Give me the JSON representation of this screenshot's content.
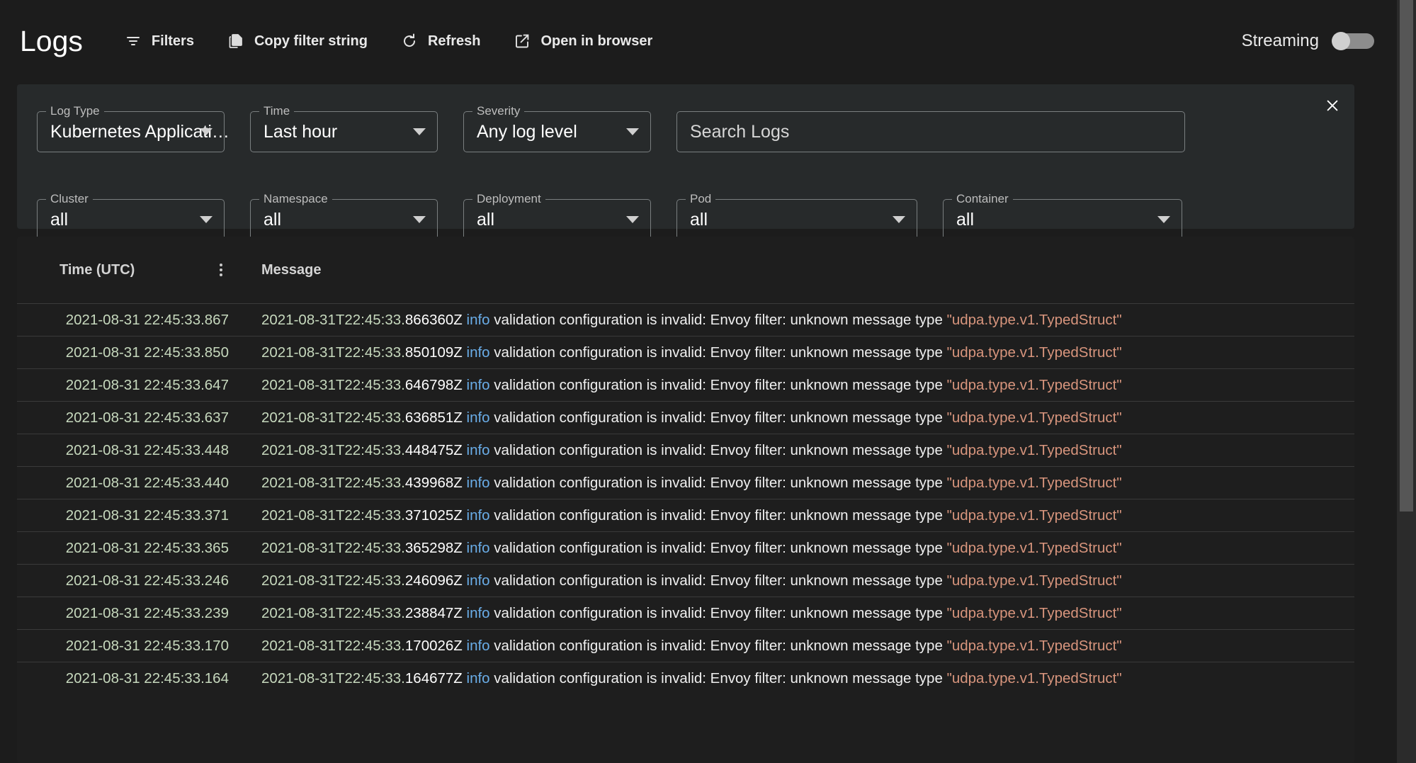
{
  "header": {
    "title": "Logs",
    "buttons": [
      {
        "label": "Filters",
        "icon": "filter-icon"
      },
      {
        "label": "Copy filter string",
        "icon": "copy-icon"
      },
      {
        "label": "Refresh",
        "icon": "refresh-icon"
      },
      {
        "label": "Open in browser",
        "icon": "external-link-icon"
      }
    ],
    "streaming": {
      "label": "Streaming",
      "state": "off"
    }
  },
  "filters": {
    "close_icon": "close-icon",
    "row1": [
      {
        "label": "Log Type",
        "value": "Kubernetes Applicati…",
        "kind": "select"
      },
      {
        "label": "Time",
        "value": "Last hour",
        "kind": "select"
      },
      {
        "label": "Severity",
        "value": "Any log level",
        "kind": "select"
      },
      {
        "label": "",
        "value": "",
        "placeholder": "Search Logs",
        "kind": "search"
      }
    ],
    "row2": [
      {
        "label": "Cluster",
        "value": "all",
        "kind": "select"
      },
      {
        "label": "Namespace",
        "value": "all",
        "kind": "select"
      },
      {
        "label": "Deployment",
        "value": "all",
        "kind": "select"
      },
      {
        "label": "Pod",
        "value": "all",
        "kind": "select"
      },
      {
        "label": "Container",
        "value": "all",
        "kind": "select"
      }
    ]
  },
  "table": {
    "columns": {
      "time": "Time (UTC)",
      "message": "Message"
    },
    "menu_icon": "more-vertical-icon",
    "message_parts": {
      "ts_prefix": "2021-08-31T22:45:33.",
      "level": "info",
      "text": " validation configuration is invalid: Envoy filter: unknown message type ",
      "quoted": "\"udpa.type.v1.TypedStruct\""
    },
    "rows": [
      {
        "time": "2021-08-31 22:45:33.867",
        "frac": "866360Z"
      },
      {
        "time": "2021-08-31 22:45:33.850",
        "frac": "850109Z"
      },
      {
        "time": "2021-08-31 22:45:33.647",
        "frac": "646798Z"
      },
      {
        "time": "2021-08-31 22:45:33.637",
        "frac": "636851Z"
      },
      {
        "time": "2021-08-31 22:45:33.448",
        "frac": "448475Z"
      },
      {
        "time": "2021-08-31 22:45:33.440",
        "frac": "439968Z"
      },
      {
        "time": "2021-08-31 22:45:33.371",
        "frac": "371025Z"
      },
      {
        "time": "2021-08-31 22:45:33.365",
        "frac": "365298Z"
      },
      {
        "time": "2021-08-31 22:45:33.246",
        "frac": "246096Z"
      },
      {
        "time": "2021-08-31 22:45:33.239",
        "frac": "238847Z"
      },
      {
        "time": "2021-08-31 22:45:33.170",
        "frac": "170026Z"
      },
      {
        "time": "2021-08-31 22:45:33.164",
        "frac": "164677Z"
      }
    ]
  },
  "colors": {
    "background": "#1c1c1c",
    "panel": "#272a2b",
    "table_bg": "#1e1e1e",
    "timestamp_green": "#c6d8bd",
    "level_blue": "#6aade8",
    "quoted_salmon": "#d8957d",
    "divider": "#3a3a3a"
  }
}
